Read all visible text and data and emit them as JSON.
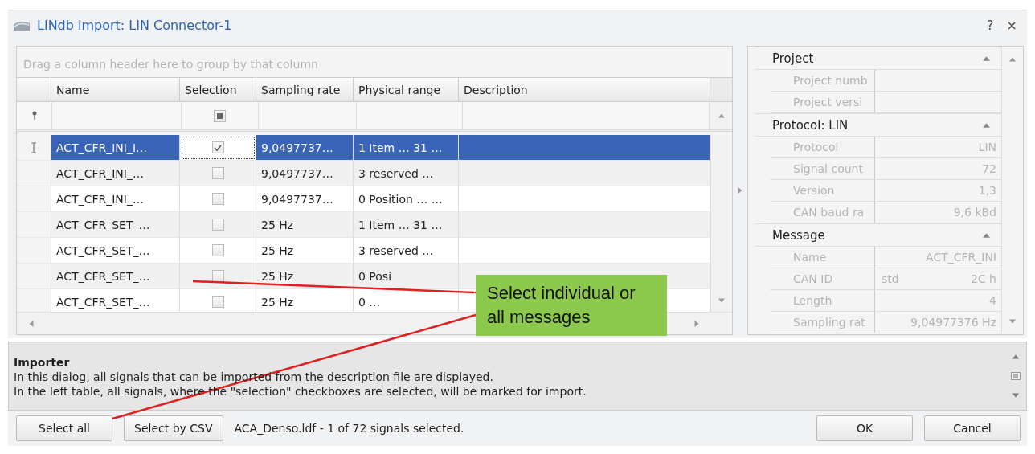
{
  "window": {
    "title": "LINdb import: LIN Connector-1",
    "help": "?",
    "close": "×"
  },
  "grid": {
    "group_hint": "Drag a column header here to group by that column",
    "columns": [
      "Name",
      "Selection",
      "Sampling rate",
      "Physical range",
      "Description"
    ],
    "filter": {
      "partially_checked": true
    },
    "rows": [
      {
        "name": "ACT_CFR_INI_I…",
        "checked": true,
        "selected": true,
        "sampling_rate": "9,0497737…",
        "physical_range": "1 Item … 31 …"
      },
      {
        "name": "ACT_CFR_INI_…",
        "checked": false,
        "selected": false,
        "sampling_rate": "9,0497737…",
        "physical_range": "3 reserved …"
      },
      {
        "name": "ACT_CFR_INI_…",
        "checked": false,
        "selected": false,
        "sampling_rate": "9,0497737…",
        "physical_range": "0 Position … …"
      },
      {
        "name": "ACT_CFR_SET_…",
        "checked": false,
        "selected": false,
        "sampling_rate": "25 Hz",
        "physical_range": "1 Item … 31 …"
      },
      {
        "name": "ACT_CFR_SET_…",
        "checked": false,
        "selected": false,
        "sampling_rate": "25 Hz",
        "physical_range": "3 reserved …"
      },
      {
        "name": "ACT_CFR_SET_…",
        "checked": false,
        "selected": false,
        "sampling_rate": "25 Hz",
        "physical_range": "0 Posi"
      },
      {
        "name": "ACT_CFR_SET_…",
        "checked": false,
        "selected": false,
        "sampling_rate": "25 Hz",
        "physical_range": "0 …"
      }
    ]
  },
  "properties": {
    "categories": [
      {
        "title": "Project",
        "expanded": true,
        "rows": [
          {
            "label": "Project numb"
          },
          {
            "label": "Project versi"
          }
        ]
      },
      {
        "title": "Protocol: LIN",
        "expanded": true,
        "rows": [
          {
            "label": "Protocol",
            "value": "LIN"
          },
          {
            "label": "Signal count",
            "value": "72"
          },
          {
            "label": "Version",
            "value": "1,3"
          },
          {
            "label": "CAN baud ra",
            "value": "9,6 kBd"
          }
        ]
      },
      {
        "title": "Message",
        "expanded": true,
        "rows": [
          {
            "label": "Name",
            "value": "ACT_CFR_INI"
          },
          {
            "label": "CAN ID",
            "qualifier": "std",
            "value": "2C  h"
          },
          {
            "label": "Length",
            "value": "4"
          },
          {
            "label": "Sampling rat",
            "value": "9,04977376 Hz"
          }
        ]
      }
    ]
  },
  "callout": {
    "text": "Select individual or all messages"
  },
  "description": {
    "title": "Importer",
    "lines": [
      "In this dialog, all signals that can be imported from the description file are displayed.",
      "In the left table, all signals, where the \"selection\" checkboxes are selected, will be marked for import."
    ]
  },
  "footer": {
    "buttons": [
      "Select all",
      "Select by CSV"
    ],
    "status": "ACA_Denso.ldf  -  1 of 72 signals selected.",
    "ok": "OK",
    "cancel": "Cancel"
  }
}
